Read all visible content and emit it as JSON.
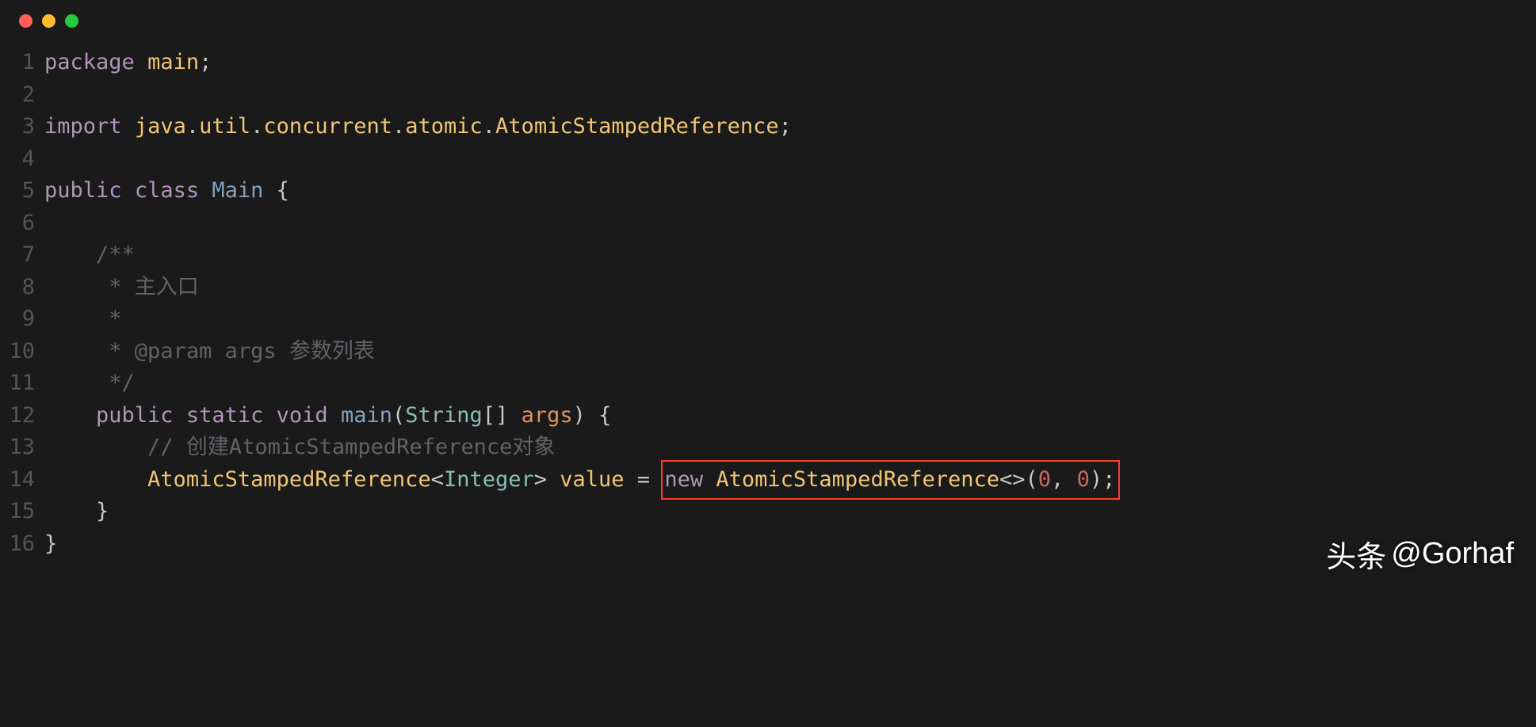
{
  "titlebar": {
    "colors": {
      "red": "#ff5f56",
      "yellow": "#ffbd2e",
      "green": "#27c93f"
    }
  },
  "code": {
    "lines": [
      {
        "n": "1",
        "tokens": [
          [
            "kw",
            "package"
          ],
          [
            "plain",
            " "
          ],
          [
            "ident",
            "main"
          ],
          [
            "punct",
            ";"
          ]
        ]
      },
      {
        "n": "2",
        "tokens": []
      },
      {
        "n": "3",
        "tokens": [
          [
            "kw",
            "import"
          ],
          [
            "plain",
            " "
          ],
          [
            "ident",
            "java"
          ],
          [
            "punct",
            "."
          ],
          [
            "ident",
            "util"
          ],
          [
            "punct",
            "."
          ],
          [
            "ident",
            "concurrent"
          ],
          [
            "punct",
            "."
          ],
          [
            "ident",
            "atomic"
          ],
          [
            "punct",
            "."
          ],
          [
            "ident",
            "AtomicStampedReference"
          ],
          [
            "punct",
            ";"
          ]
        ]
      },
      {
        "n": "4",
        "tokens": []
      },
      {
        "n": "5",
        "tokens": [
          [
            "kw",
            "public"
          ],
          [
            "plain",
            " "
          ],
          [
            "kw",
            "class"
          ],
          [
            "plain",
            " "
          ],
          [
            "type",
            "Main"
          ],
          [
            "plain",
            " "
          ],
          [
            "punct",
            "{"
          ]
        ]
      },
      {
        "n": "6",
        "tokens": []
      },
      {
        "n": "7",
        "tokens": [
          [
            "plain",
            "    "
          ],
          [
            "comment",
            "/**"
          ]
        ]
      },
      {
        "n": "8",
        "tokens": [
          [
            "plain",
            "     "
          ],
          [
            "comment",
            "* 主入口"
          ]
        ]
      },
      {
        "n": "9",
        "tokens": [
          [
            "plain",
            "     "
          ],
          [
            "comment",
            "*"
          ]
        ]
      },
      {
        "n": "10",
        "tokens": [
          [
            "plain",
            "     "
          ],
          [
            "comment",
            "* @param args 参数列表"
          ]
        ]
      },
      {
        "n": "11",
        "tokens": [
          [
            "plain",
            "     "
          ],
          [
            "comment",
            "*/"
          ]
        ]
      },
      {
        "n": "12",
        "tokens": [
          [
            "plain",
            "    "
          ],
          [
            "kw",
            "public"
          ],
          [
            "plain",
            " "
          ],
          [
            "kw",
            "static"
          ],
          [
            "plain",
            " "
          ],
          [
            "void",
            "void"
          ],
          [
            "plain",
            " "
          ],
          [
            "type",
            "main"
          ],
          [
            "punct",
            "("
          ],
          [
            "string-type",
            "String"
          ],
          [
            "punct",
            "[] "
          ],
          [
            "args",
            "args"
          ],
          [
            "punct",
            ") {"
          ]
        ]
      },
      {
        "n": "13",
        "tokens": [
          [
            "plain",
            "        "
          ],
          [
            "comment",
            "// 创建AtomicStampedReference对象"
          ]
        ]
      },
      {
        "n": "14",
        "tokens": [
          [
            "plain",
            "        "
          ],
          [
            "ident",
            "AtomicStampedReference"
          ],
          [
            "punct",
            "<"
          ],
          [
            "string-type",
            "Integer"
          ],
          [
            "punct",
            "> "
          ],
          [
            "ident",
            "value"
          ],
          [
            "plain",
            " "
          ],
          [
            "punct",
            "="
          ],
          [
            "plain",
            " "
          ]
        ],
        "boxed_tokens": [
          [
            "kw",
            "new"
          ],
          [
            "plain",
            " "
          ],
          [
            "ident",
            "AtomicStampedReference"
          ],
          [
            "punct",
            "<>("
          ],
          [
            "number",
            "0"
          ],
          [
            "punct",
            ", "
          ],
          [
            "number",
            "0"
          ],
          [
            "punct",
            ");"
          ]
        ]
      },
      {
        "n": "15",
        "tokens": [
          [
            "plain",
            "    "
          ],
          [
            "punct",
            "}"
          ]
        ]
      },
      {
        "n": "16",
        "tokens": [
          [
            "punct",
            "}"
          ]
        ]
      }
    ]
  },
  "watermark": {
    "prefix": "头条",
    "handle": "@Gorhaf"
  }
}
